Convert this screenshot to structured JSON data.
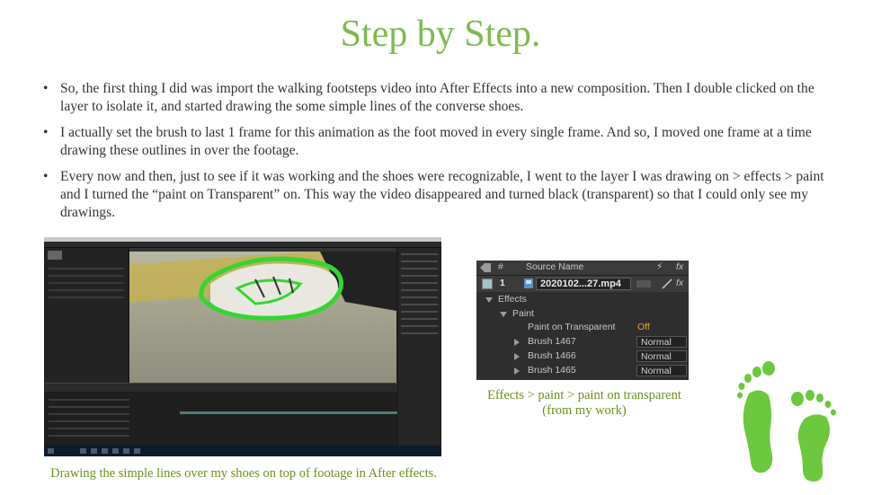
{
  "slide": {
    "title": "Step by Step.",
    "bullet_char": "•",
    "bullets": [
      "So, the first thing I did was import the walking footsteps video into After Effects into a new composition. Then I double clicked on the layer to isolate it, and started drawing the some simple lines of the converse shoes.",
      "I actually set the brush to last 1 frame for this animation as the foot moved in every single frame. And so, I moved one frame at a time drawing these outlines in over the footage.",
      "Every now and then, just to see if it was working and the shoes were recognizable, I went to the layer I was drawing on > effects > paint and I turned the “paint on Transparent” on. This way the video disappeared and turned black (transparent) so that I could only see my drawings."
    ],
    "caption_left": "Drawing the simple lines over my shoes on top of footage in After effects.",
    "caption_right_line1": "Effects > paint > paint on transparent",
    "caption_right_line2": "(from my work)"
  },
  "layer_panel": {
    "header_number": "#",
    "header_source": "Source Name",
    "header_switch": "⚡",
    "header_fx": "fx",
    "layer_number": "1",
    "layer_name": "2020102...27.mp4",
    "layer_fx": "fx",
    "effects_label": "Effects",
    "paint_label": "Paint",
    "paint_on_transparent_label": "Paint on Transparent",
    "paint_on_transparent_value": "Off",
    "brushes": [
      {
        "name": "Brush 1467",
        "mode": "Normal"
      },
      {
        "name": "Brush 1466",
        "mode": "Normal"
      },
      {
        "name": "Brush 1465",
        "mode": "Normal"
      }
    ]
  },
  "colors": {
    "accent_green": "#7dbb4e",
    "caption_olive": "#6e8f1c",
    "off_orange": "#e8a23a",
    "stroke_green": "#35d62f",
    "feet_green": "#6cc83c"
  },
  "icons": [
    "after-effects-screenshot",
    "footprints-icon"
  ]
}
